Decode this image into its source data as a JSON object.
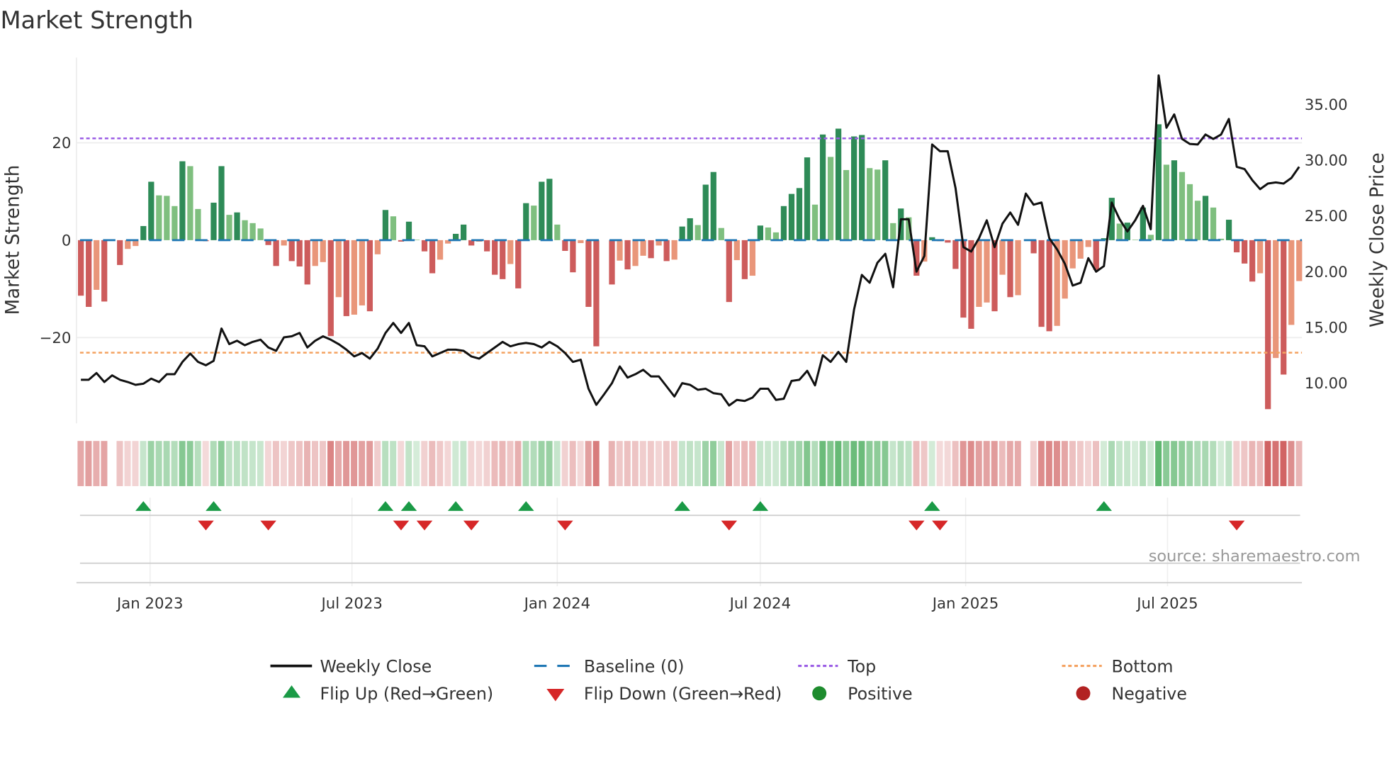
{
  "chart_data": {
    "type": "bar+line",
    "title": "Market Strength",
    "ylabel_left": "Market Strength",
    "ylabel_right": "Weekly Close Price",
    "start_date": "2022-10-31",
    "frequency_days": 7,
    "ylim_left": [
      -37.6,
      37.5
    ],
    "ylim_right": [
      6.4,
      39.2
    ],
    "left_ticks": [
      {
        "v": 20,
        "label": "20"
      },
      {
        "v": 0,
        "label": "0"
      },
      {
        "v": -20,
        "label": "−20"
      }
    ],
    "right_ticks": [
      {
        "v": 35,
        "label": "35.00"
      },
      {
        "v": 30,
        "label": "30.00"
      },
      {
        "v": 25,
        "label": "25.00"
      },
      {
        "v": 20,
        "label": "20.00"
      },
      {
        "v": 15,
        "label": "15.00"
      },
      {
        "v": 10,
        "label": "10.00"
      }
    ],
    "x_ticks": [
      {
        "date": "2023-01-01",
        "label": "Jan 2023"
      },
      {
        "date": "2023-07-01",
        "label": "Jul 2023"
      },
      {
        "date": "2024-01-01",
        "label": "Jan 2024"
      },
      {
        "date": "2024-07-01",
        "label": "Jul 2024"
      },
      {
        "date": "2025-01-01",
        "label": "Jan 2025"
      },
      {
        "date": "2025-07-01",
        "label": "Jul 2025"
      }
    ],
    "top_level": 20.9,
    "bottom_level": -23.1,
    "baseline": 0,
    "strength": [
      -11.4,
      -13.7,
      -10.2,
      -12.6,
      0,
      -5.1,
      -1.8,
      -1.2,
      2.9,
      12.0,
      9.2,
      9.1,
      7.0,
      16.2,
      15.2,
      6.4,
      -0.2,
      7.7,
      15.2,
      5.2,
      5.7,
      4.1,
      3.5,
      2.4,
      -1.0,
      -5.3,
      -1.1,
      -4.3,
      -5.4,
      -9.1,
      -5.3,
      -4.5,
      -19.7,
      -11.7,
      -15.6,
      -15.3,
      -13.4,
      -14.6,
      -2.9,
      6.2,
      4.9,
      -0.3,
      3.8,
      0.1,
      -2.3,
      -6.8,
      -4.0,
      -0.7,
      1.3,
      3.2,
      -1.1,
      -0.3,
      -2.3,
      -7.1,
      -8.0,
      -4.9,
      -9.9,
      7.6,
      7.1,
      12.0,
      12.6,
      3.2,
      -2.2,
      -6.6,
      -0.6,
      -13.7,
      -21.8,
      0,
      -9.1,
      -4.2,
      -6.0,
      -5.3,
      -3.2,
      -3.7,
      -1.1,
      -4.3,
      -4.0,
      2.8,
      4.5,
      3.1,
      11.4,
      14.0,
      2.5,
      -12.7,
      -4.1,
      -8.0,
      -7.3,
      3.0,
      2.6,
      1.6,
      7.0,
      9.5,
      10.7,
      17.0,
      7.3,
      21.7,
      17.1,
      22.9,
      14.4,
      21.3,
      21.6,
      14.8,
      14.5,
      16.4,
      3.5,
      6.5,
      4.7,
      -7.3,
      -4.4,
      0.6,
      -0.2,
      -0.5,
      -5.9,
      -15.9,
      -18.2,
      -13.7,
      -12.8,
      -14.6,
      -7.1,
      -11.7,
      -11.3,
      0,
      -2.7,
      -17.8,
      -18.7,
      -17.6,
      -12.0,
      -5.8,
      -3.8,
      -1.4,
      -6.1,
      0.4,
      8.7,
      3.4,
      3.6,
      0.1,
      6.7,
      1.1,
      23.8,
      15.5,
      16.4,
      14.0,
      11.5,
      8.1,
      9.1,
      6.7,
      0.3,
      4.2,
      -2.5,
      -4.8,
      -8.5,
      -6.8,
      -34.7,
      -24.2,
      -27.6,
      -17.4,
      -8.4
    ],
    "weekly_close": [
      10.3,
      10.3,
      10.9,
      10.1,
      10.7,
      10.3,
      10.1,
      9.85,
      9.95,
      10.4,
      10.1,
      10.8,
      10.8,
      11.9,
      12.65,
      11.9,
      11.6,
      12.0,
      14.9,
      13.5,
      13.8,
      13.4,
      13.7,
      13.9,
      13.2,
      12.9,
      14.1,
      14.2,
      14.5,
      13.2,
      13.8,
      14.2,
      13.9,
      13.5,
      13.0,
      12.4,
      12.7,
      12.2,
      13.1,
      14.5,
      15.4,
      14.5,
      15.4,
      13.4,
      13.3,
      12.4,
      12.7,
      13.0,
      13.0,
      12.9,
      12.4,
      12.2,
      12.7,
      13.2,
      13.7,
      13.3,
      13.5,
      13.6,
      13.5,
      13.2,
      13.7,
      13.3,
      12.7,
      11.9,
      12.1,
      9.5,
      8.05,
      9.0,
      10.0,
      11.5,
      10.5,
      10.8,
      11.2,
      10.6,
      10.6,
      9.7,
      8.8,
      10.0,
      9.85,
      9.4,
      9.5,
      9.1,
      9.0,
      8.0,
      8.5,
      8.4,
      8.7,
      9.5,
      9.5,
      8.5,
      8.6,
      10.2,
      10.3,
      11.1,
      9.8,
      12.5,
      11.9,
      12.8,
      11.9,
      16.6,
      19.7,
      19.0,
      20.8,
      21.6,
      18.6,
      24.7,
      24.7,
      20.0,
      21.4,
      31.4,
      30.8,
      30.8,
      27.5,
      22.2,
      21.8,
      23.0,
      24.6,
      22.2,
      24.3,
      25.3,
      24.2,
      27.0,
      26.0,
      26.2,
      23.0,
      22.0,
      20.7,
      18.75,
      19.0,
      21.2,
      20.0,
      20.5,
      26.2,
      24.7,
      23.6,
      24.6,
      25.9,
      23.8,
      37.6,
      32.9,
      34.1,
      31.9,
      31.45,
      31.4,
      32.3,
      31.9,
      32.3,
      33.7,
      29.4,
      29.2,
      28.2,
      27.4,
      27.9,
      28.0,
      27.9,
      28.4,
      29.4
    ],
    "flip_up_indices": [
      8,
      17,
      39,
      42,
      48,
      57,
      77,
      87,
      109,
      131
    ],
    "flip_down_indices": [
      16,
      24,
      41,
      44,
      50,
      62,
      83,
      107,
      110,
      148
    ],
    "legend": {
      "weekly_close": "Weekly Close",
      "baseline": "Baseline (0)",
      "top": "Top",
      "bottom": "Bottom",
      "flip_up": "Flip Up (Red→Green)",
      "flip_down": "Flip Down (Green→Red)",
      "positive": "Positive",
      "negative": "Negative"
    },
    "source": "source: sharemaestro.com",
    "colors": {
      "pos_strong": "#2e8b57",
      "pos_weak": "#7fbf7f",
      "neg_strong": "#cd5c5c",
      "neg_weak": "#e9967a",
      "top": "#9b5de5",
      "bottom": "#f4a261",
      "baseline": "#1f77b4",
      "line": "#111111",
      "flip_up": "#1a9a46",
      "flip_down": "#d62728",
      "positive": "#1e8c2e",
      "negative": "#b22222"
    }
  }
}
